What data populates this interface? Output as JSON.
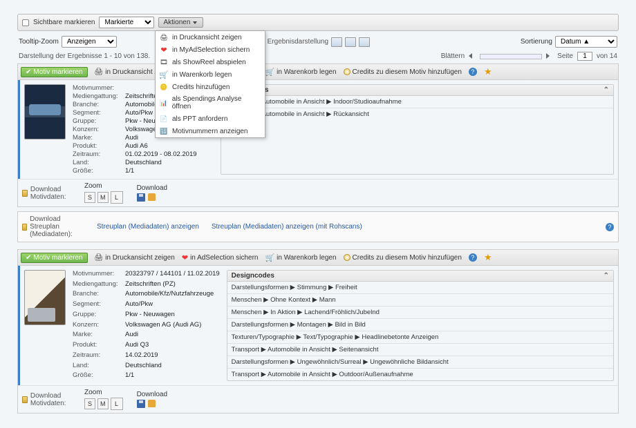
{
  "topbar": {
    "mark_visible": "Sichtbare markieren",
    "filter_selected": "Markierte",
    "actions_label": "Aktionen"
  },
  "dropdown": {
    "items": [
      {
        "icon": "🖨",
        "label": "in Druckansicht zeigen"
      },
      {
        "icon": "❤",
        "label": "in MyAdSelection sichern"
      },
      {
        "icon": "🎞",
        "label": "als ShowReel abspielen"
      },
      {
        "icon": "🛒",
        "label": "in Warenkorb legen"
      },
      {
        "icon": "🪙",
        "label": "Credits hinzufügen"
      },
      {
        "icon": "📊",
        "label": "als Spendings Analyse öffnen"
      },
      {
        "icon": "📄",
        "label": "als PPT anfordern"
      },
      {
        "icon": "🔢",
        "label": "Motivnummern anzeigen"
      }
    ]
  },
  "row2": {
    "tooltip_zoom": "Tooltip-Zoom",
    "zoom_option": "Anzeigen",
    "result_layout": "Ergebnisdarstellung",
    "sort_label": "Sortierung",
    "sort_value": "Datum ▲"
  },
  "row3": {
    "results_text": "Darstellung der Ergebnisse 1 - 10 von 138.",
    "browse": "Blättern",
    "page_label": "Seite",
    "page_value": "1",
    "page_of": "von 14"
  },
  "actionbar": {
    "mark": "Motiv markieren",
    "print": "in Druckansicht zeigen",
    "adsel": "in AdSelection sichern",
    "cart": "in Warenkorb legen",
    "credits": "Credits zu diesem Motiv hinzufügen"
  },
  "meta_labels": {
    "motivnr": "Motivnummer:",
    "mediengattung": "Mediengattung:",
    "branche": "Branche:",
    "segment": "Segment:",
    "gruppe": "Gruppe:",
    "konzern": "Konzern:",
    "marke": "Marke:",
    "produkt": "Produkt:",
    "zeitraum": "Zeitraum:",
    "land": "Land:",
    "groesse": "Größe:"
  },
  "result1": {
    "mediengattung": "Zeitschriften (PZ)",
    "branche": "Automobile/Kfz/Nutzfahrzeuge",
    "segment": "Auto/Pkw",
    "gruppe": "Pkw - Neuwagen",
    "konzern": "Volkswagen AG (Audi AG)",
    "marke": "Audi",
    "produkt": "Audi A6",
    "zeitraum": "01.02.2019 - 08.02.2019",
    "land": "Deutschland",
    "groesse": "1/1",
    "designcodes_title": "Designcodes",
    "dc": [
      "Transport ▶ Automobile in Ansicht ▶ Indoor/Studioaufnahme",
      "Transport ▶ Automobile in Ansicht ▶ Rückansicht"
    ]
  },
  "result2": {
    "motivnr": "20323797 / 144101 / 11.02.2019",
    "mediengattung": "Zeitschriften (PZ)",
    "branche": "Automobile/Kfz/Nutzfahrzeuge",
    "segment": "Auto/Pkw",
    "gruppe": "Pkw - Neuwagen",
    "konzern": "Volkswagen AG (Audi AG)",
    "marke": "Audi",
    "produkt": "Audi Q3",
    "zeitraum": "14.02.2019",
    "land": "Deutschland",
    "groesse": "1/1",
    "designcodes_title": "Designcodes",
    "dc": [
      "Darstellungsformen ▶ Stimmung ▶ Freiheit",
      "Menschen ▶ Ohne Kontext ▶ Mann",
      "Menschen ▶ In Aktion ▶ Lachend/Fröhlich/Jubelnd",
      "Darstellungsformen ▶ Montagen ▶ Bild in Bild",
      "Texturen/Typographie ▶ Text/Typographie ▶ Headlinebetonte Anzeigen",
      "Transport ▶ Automobile in Ansicht ▶ Seitenansicht",
      "Darstellungsformen ▶ Ungewöhnlich/Surreal ▶ Ungewöhnliche Bildansicht",
      "Transport ▶ Automobile in Ansicht ▶ Outdoor/Außenaufnahme"
    ]
  },
  "download": {
    "motivdaten": "Download Motivdaten:",
    "zoom": "Zoom",
    "dl": "Download",
    "s": "S",
    "m": "M",
    "l": "L",
    "streuplan": "Download Streuplan (Mediadaten):",
    "streuplan_show": "Streuplan (Mediadaten) anzeigen",
    "streuplan_roh": "Streuplan (Mediadaten) anzeigen (mit Rohscans)"
  }
}
